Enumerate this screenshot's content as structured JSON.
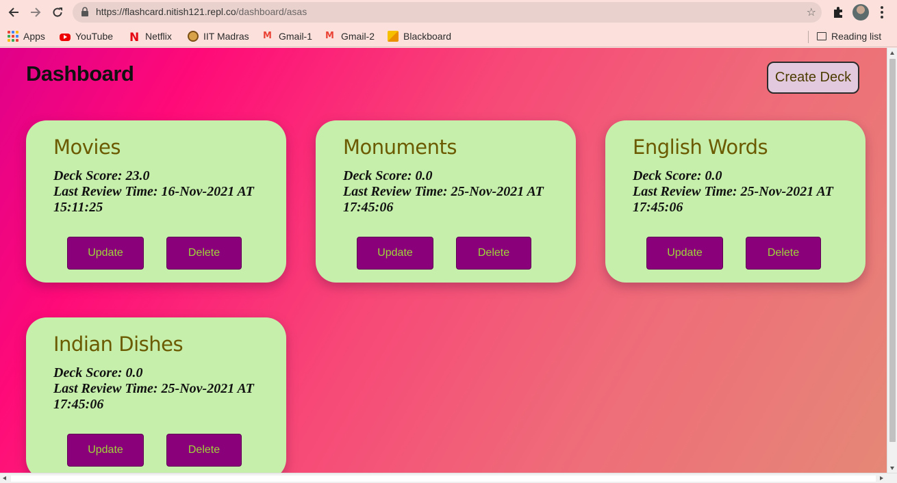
{
  "browser": {
    "url_host": "https://flashcard.nitish121.repl.co",
    "url_path": "/dashboard/asas",
    "icons": [
      "back-arrow-icon",
      "forward-arrow-icon",
      "reload-icon",
      "lock-icon",
      "star-icon",
      "puzzle-icon",
      "avatar",
      "kebab-menu-icon"
    ]
  },
  "bookmarks": {
    "items": [
      {
        "label": "Apps",
        "icon": "apps-grid-icon"
      },
      {
        "label": "YouTube",
        "icon": "youtube-icon"
      },
      {
        "label": "Netflix",
        "icon": "netflix-icon"
      },
      {
        "label": "IIT Madras",
        "icon": "iit-madras-icon"
      },
      {
        "label": "Gmail-1",
        "icon": "gmail-icon"
      },
      {
        "label": "Gmail-2",
        "icon": "gmail-icon"
      },
      {
        "label": "Blackboard",
        "icon": "blackboard-icon"
      }
    ],
    "reading_list": "Reading list"
  },
  "page": {
    "title": "Dashboard",
    "create_deck_label": "Create Deck"
  },
  "decks": [
    {
      "name": "Movies",
      "score_line": "Deck Score: 23.0",
      "review_line": "Last Review Time: 16-Nov-2021 AT 15:11:25",
      "update_label": "Update",
      "delete_label": "Delete"
    },
    {
      "name": "Monuments",
      "score_line": "Deck Score: 0.0",
      "review_line": "Last Review Time: 25-Nov-2021 AT 17:45:06",
      "update_label": "Update",
      "delete_label": "Delete"
    },
    {
      "name": "English Words",
      "score_line": "Deck Score: 0.0",
      "review_line": "Last Review Time: 25-Nov-2021 AT 17:45:06",
      "update_label": "Update",
      "delete_label": "Delete"
    },
    {
      "name": "Indian Dishes",
      "score_line": "Deck Score: 0.0",
      "review_line": "Last Review Time: 25-Nov-2021 AT 17:45:06",
      "update_label": "Update",
      "delete_label": "Delete"
    }
  ],
  "colors": {
    "card_bg": "#c5efab",
    "button_bg": "#8a007a",
    "button_text": "#9fd63a",
    "deck_title": "#6b5a00",
    "gradient_start": "#e0008a",
    "gradient_end": "#e58877"
  }
}
